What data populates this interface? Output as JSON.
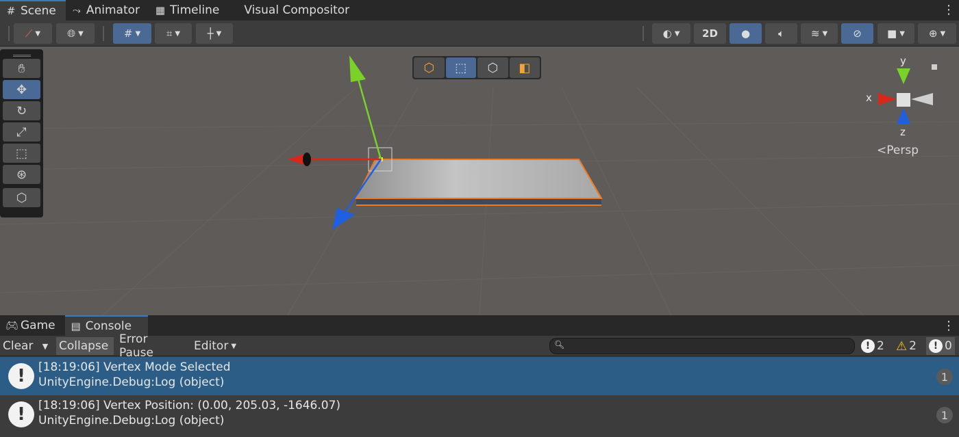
{
  "top_tabs": [
    {
      "label": "Scene",
      "icon": "grid-icon"
    },
    {
      "label": "Animator",
      "icon": "animator-icon"
    },
    {
      "label": "Timeline",
      "icon": "timeline-icon"
    },
    {
      "label": "Visual Compositor",
      "icon": ""
    }
  ],
  "scene_toolbar": {
    "mode_2d": "2D"
  },
  "gizmo": {
    "x_label": "x",
    "y_label": "y",
    "z_label": "z",
    "projection": "Persp"
  },
  "bottom_tabs": [
    {
      "label": "Game",
      "icon": "gamepad-icon"
    },
    {
      "label": "Console",
      "icon": "console-icon"
    }
  ],
  "console_toolbar": {
    "clear": "Clear",
    "collapse": "Collapse",
    "error_pause": "Error Pause",
    "editor": "Editor",
    "search_placeholder": "",
    "info_count": "2",
    "warning_count": "2",
    "error_count": "0"
  },
  "console_rows": [
    {
      "line1": "[18:19:06] Vertex Mode Selected",
      "line2": "UnityEngine.Debug:Log (object)",
      "count": "1"
    },
    {
      "line1": "[18:19:06] Vertex Position: (0.00, 205.03, -1646.07)",
      "line2": "UnityEngine.Debug:Log (object)",
      "count": "1"
    }
  ],
  "colors": {
    "accent": "#3a79bb",
    "selected_row": "#2c5d87",
    "scene_bg": "#5f5b58",
    "x_axis": "#d8271b",
    "y_axis": "#79d12a",
    "z_axis": "#1f5fe0",
    "selection_outline": "#f07a1f"
  }
}
